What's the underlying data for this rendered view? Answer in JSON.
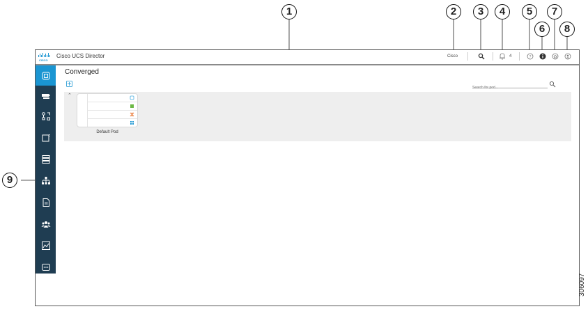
{
  "app": {
    "title": "Cisco UCS Director"
  },
  "header": {
    "user": "Cisco",
    "notification_count": "4"
  },
  "main": {
    "title": "Converged",
    "search_placeholder": "Search for pod...",
    "pods": [
      {
        "label": "Default Pod"
      }
    ]
  },
  "sidebar": {
    "items": [
      {
        "name": "converged",
        "icon": "converged-icon",
        "active": true
      },
      {
        "name": "virtual",
        "icon": "virtual-icon"
      },
      {
        "name": "physical",
        "icon": "physical-icon"
      },
      {
        "name": "policies",
        "icon": "policies-icon"
      },
      {
        "name": "storage",
        "icon": "storage-icon"
      },
      {
        "name": "network",
        "icon": "hierarchy-icon"
      },
      {
        "name": "catalogs",
        "icon": "catalog-icon"
      },
      {
        "name": "groups",
        "icon": "users-icon"
      },
      {
        "name": "reports",
        "icon": "chart-icon"
      },
      {
        "name": "more",
        "icon": "more-icon"
      }
    ]
  },
  "callouts": [
    "1",
    "2",
    "3",
    "4",
    "5",
    "6",
    "7",
    "8",
    "9"
  ],
  "figure_id": "306097",
  "colors": {
    "sidebar": "#1f3d52",
    "active": "#1a95d2",
    "panel": "#eeeeee"
  }
}
